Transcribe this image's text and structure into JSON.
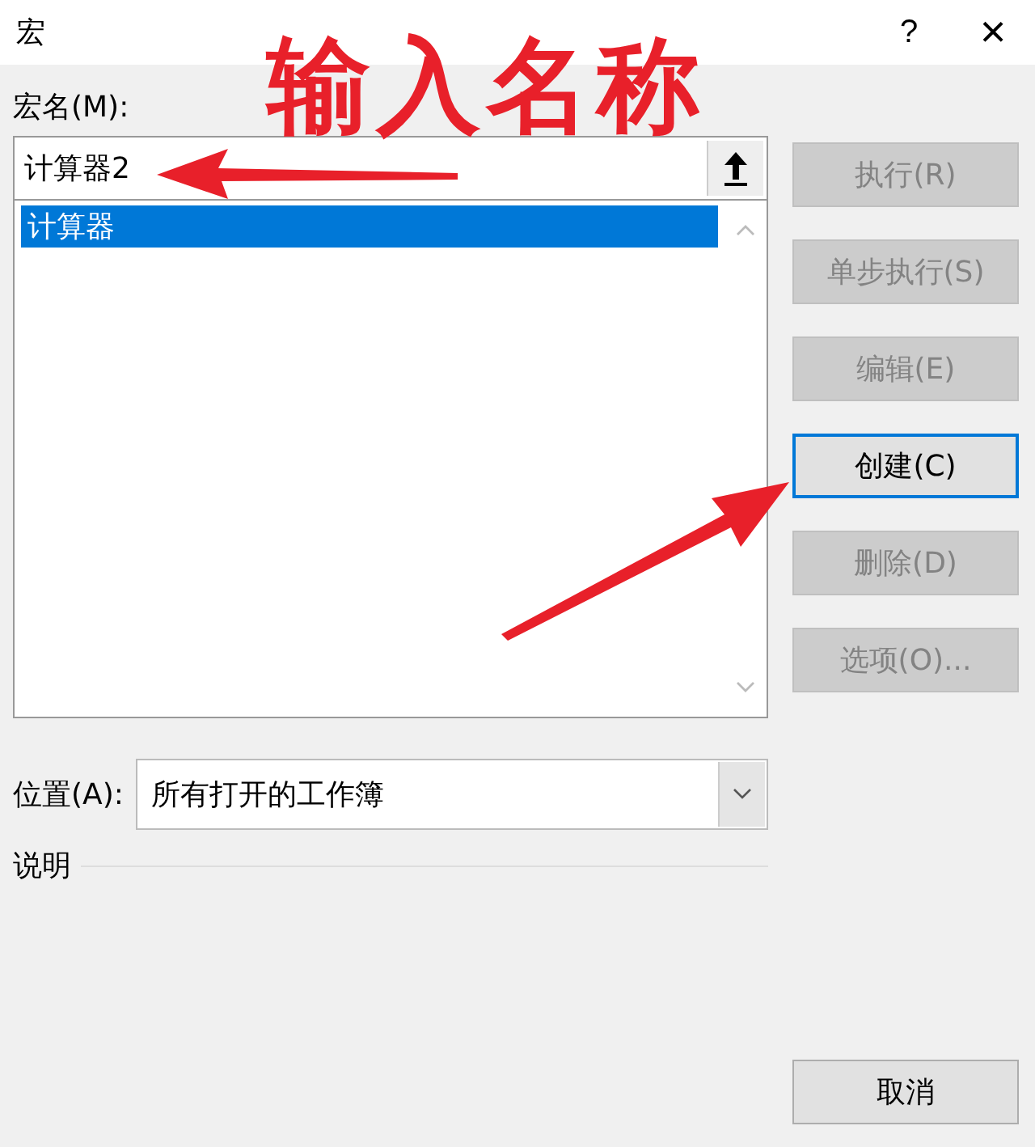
{
  "window": {
    "title": "宏",
    "help": "?",
    "close": "×"
  },
  "annotation": {
    "headline": "输入名称"
  },
  "name_field": {
    "label": "宏名(M):",
    "value": "计算器2"
  },
  "macro_list": {
    "items": [
      {
        "label": "计算器",
        "selected": true
      }
    ]
  },
  "buttons": [
    {
      "label": "执行(R)",
      "disabled": true,
      "default": false
    },
    {
      "label": "单步执行(S)",
      "disabled": true,
      "default": false
    },
    {
      "label": "编辑(E)",
      "disabled": true,
      "default": false
    },
    {
      "label": "创建(C)",
      "disabled": false,
      "default": true
    },
    {
      "label": "删除(D)",
      "disabled": true,
      "default": false
    },
    {
      "label": "选项(O)...",
      "disabled": true,
      "default": false
    }
  ],
  "location": {
    "label": "位置(A):",
    "value": "所有打开的工作簿"
  },
  "description": {
    "label": "说明"
  },
  "cancel_button": {
    "label": "取消"
  }
}
